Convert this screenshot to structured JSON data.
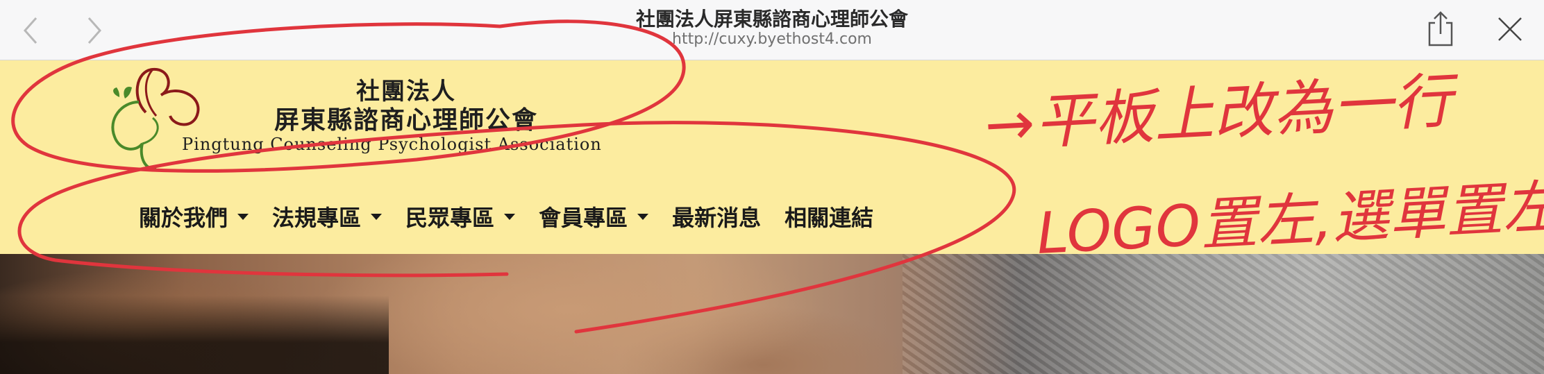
{
  "browser": {
    "page_title": "社團法人屏東縣諮商心理師公會",
    "url": "http://cuxy.byethost4.com"
  },
  "header": {
    "org_line1": "社團法人",
    "org_line2": "屏東縣諮商心理師公會",
    "org_english": "Pingtung Counseling Psychologist Association"
  },
  "nav": {
    "items": [
      {
        "label": "關於我們",
        "dropdown": true
      },
      {
        "label": "法規專區",
        "dropdown": true
      },
      {
        "label": "民眾專區",
        "dropdown": true
      },
      {
        "label": "會員專區",
        "dropdown": true
      },
      {
        "label": "最新消息",
        "dropdown": false
      },
      {
        "label": "相關連結",
        "dropdown": false
      }
    ]
  },
  "annotation": {
    "line1": "→平板上改為一行",
    "line2": "LOGO置左,選單置左"
  },
  "colors": {
    "header_bg": "#fcec9f",
    "annotation_red": "#e0353d",
    "logo_red": "#8b1a1a",
    "logo_green": "#4a8a2a"
  }
}
